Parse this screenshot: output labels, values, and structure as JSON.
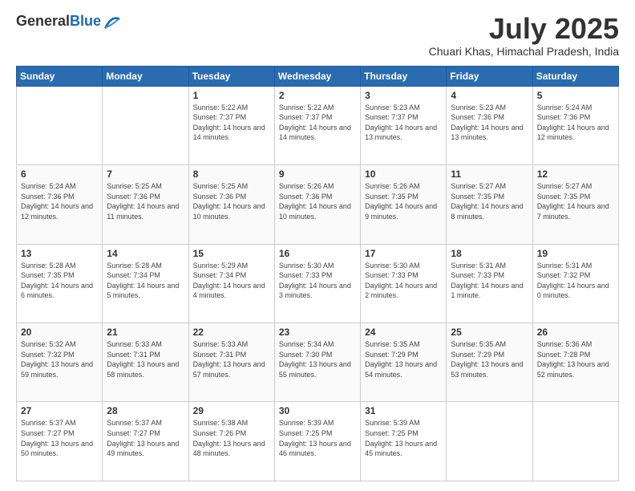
{
  "header": {
    "logo": {
      "general": "General",
      "blue": "Blue"
    },
    "title": "July 2025",
    "location": "Chuari Khas, Himachal Pradesh, India"
  },
  "weekdays": [
    "Sunday",
    "Monday",
    "Tuesday",
    "Wednesday",
    "Thursday",
    "Friday",
    "Saturday"
  ],
  "weeks": [
    [
      {
        "day": "",
        "sunrise": "",
        "sunset": "",
        "daylight": ""
      },
      {
        "day": "",
        "sunrise": "",
        "sunset": "",
        "daylight": ""
      },
      {
        "day": "1",
        "sunrise": "Sunrise: 5:22 AM",
        "sunset": "Sunset: 7:37 PM",
        "daylight": "Daylight: 14 hours and 14 minutes."
      },
      {
        "day": "2",
        "sunrise": "Sunrise: 5:22 AM",
        "sunset": "Sunset: 7:37 PM",
        "daylight": "Daylight: 14 hours and 14 minutes."
      },
      {
        "day": "3",
        "sunrise": "Sunrise: 5:23 AM",
        "sunset": "Sunset: 7:37 PM",
        "daylight": "Daylight: 14 hours and 13 minutes."
      },
      {
        "day": "4",
        "sunrise": "Sunrise: 5:23 AM",
        "sunset": "Sunset: 7:36 PM",
        "daylight": "Daylight: 14 hours and 13 minutes."
      },
      {
        "day": "5",
        "sunrise": "Sunrise: 5:24 AM",
        "sunset": "Sunset: 7:36 PM",
        "daylight": "Daylight: 14 hours and 12 minutes."
      }
    ],
    [
      {
        "day": "6",
        "sunrise": "Sunrise: 5:24 AM",
        "sunset": "Sunset: 7:36 PM",
        "daylight": "Daylight: 14 hours and 12 minutes."
      },
      {
        "day": "7",
        "sunrise": "Sunrise: 5:25 AM",
        "sunset": "Sunset: 7:36 PM",
        "daylight": "Daylight: 14 hours and 11 minutes."
      },
      {
        "day": "8",
        "sunrise": "Sunrise: 5:25 AM",
        "sunset": "Sunset: 7:36 PM",
        "daylight": "Daylight: 14 hours and 10 minutes."
      },
      {
        "day": "9",
        "sunrise": "Sunrise: 5:26 AM",
        "sunset": "Sunset: 7:36 PM",
        "daylight": "Daylight: 14 hours and 10 minutes."
      },
      {
        "day": "10",
        "sunrise": "Sunrise: 5:26 AM",
        "sunset": "Sunset: 7:35 PM",
        "daylight": "Daylight: 14 hours and 9 minutes."
      },
      {
        "day": "11",
        "sunrise": "Sunrise: 5:27 AM",
        "sunset": "Sunset: 7:35 PM",
        "daylight": "Daylight: 14 hours and 8 minutes."
      },
      {
        "day": "12",
        "sunrise": "Sunrise: 5:27 AM",
        "sunset": "Sunset: 7:35 PM",
        "daylight": "Daylight: 14 hours and 7 minutes."
      }
    ],
    [
      {
        "day": "13",
        "sunrise": "Sunrise: 5:28 AM",
        "sunset": "Sunset: 7:35 PM",
        "daylight": "Daylight: 14 hours and 6 minutes."
      },
      {
        "day": "14",
        "sunrise": "Sunrise: 5:28 AM",
        "sunset": "Sunset: 7:34 PM",
        "daylight": "Daylight: 14 hours and 5 minutes."
      },
      {
        "day": "15",
        "sunrise": "Sunrise: 5:29 AM",
        "sunset": "Sunset: 7:34 PM",
        "daylight": "Daylight: 14 hours and 4 minutes."
      },
      {
        "day": "16",
        "sunrise": "Sunrise: 5:30 AM",
        "sunset": "Sunset: 7:33 PM",
        "daylight": "Daylight: 14 hours and 3 minutes."
      },
      {
        "day": "17",
        "sunrise": "Sunrise: 5:30 AM",
        "sunset": "Sunset: 7:33 PM",
        "daylight": "Daylight: 14 hours and 2 minutes."
      },
      {
        "day": "18",
        "sunrise": "Sunrise: 5:31 AM",
        "sunset": "Sunset: 7:33 PM",
        "daylight": "Daylight: 14 hours and 1 minute."
      },
      {
        "day": "19",
        "sunrise": "Sunrise: 5:31 AM",
        "sunset": "Sunset: 7:32 PM",
        "daylight": "Daylight: 14 hours and 0 minutes."
      }
    ],
    [
      {
        "day": "20",
        "sunrise": "Sunrise: 5:32 AM",
        "sunset": "Sunset: 7:32 PM",
        "daylight": "Daylight: 13 hours and 59 minutes."
      },
      {
        "day": "21",
        "sunrise": "Sunrise: 5:33 AM",
        "sunset": "Sunset: 7:31 PM",
        "daylight": "Daylight: 13 hours and 58 minutes."
      },
      {
        "day": "22",
        "sunrise": "Sunrise: 5:33 AM",
        "sunset": "Sunset: 7:31 PM",
        "daylight": "Daylight: 13 hours and 57 minutes."
      },
      {
        "day": "23",
        "sunrise": "Sunrise: 5:34 AM",
        "sunset": "Sunset: 7:30 PM",
        "daylight": "Daylight: 13 hours and 55 minutes."
      },
      {
        "day": "24",
        "sunrise": "Sunrise: 5:35 AM",
        "sunset": "Sunset: 7:29 PM",
        "daylight": "Daylight: 13 hours and 54 minutes."
      },
      {
        "day": "25",
        "sunrise": "Sunrise: 5:35 AM",
        "sunset": "Sunset: 7:29 PM",
        "daylight": "Daylight: 13 hours and 53 minutes."
      },
      {
        "day": "26",
        "sunrise": "Sunrise: 5:36 AM",
        "sunset": "Sunset: 7:28 PM",
        "daylight": "Daylight: 13 hours and 52 minutes."
      }
    ],
    [
      {
        "day": "27",
        "sunrise": "Sunrise: 5:37 AM",
        "sunset": "Sunset: 7:27 PM",
        "daylight": "Daylight: 13 hours and 50 minutes."
      },
      {
        "day": "28",
        "sunrise": "Sunrise: 5:37 AM",
        "sunset": "Sunset: 7:27 PM",
        "daylight": "Daylight: 13 hours and 49 minutes."
      },
      {
        "day": "29",
        "sunrise": "Sunrise: 5:38 AM",
        "sunset": "Sunset: 7:26 PM",
        "daylight": "Daylight: 13 hours and 48 minutes."
      },
      {
        "day": "30",
        "sunrise": "Sunrise: 5:39 AM",
        "sunset": "Sunset: 7:25 PM",
        "daylight": "Daylight: 13 hours and 46 minutes."
      },
      {
        "day": "31",
        "sunrise": "Sunrise: 5:39 AM",
        "sunset": "Sunset: 7:25 PM",
        "daylight": "Daylight: 13 hours and 45 minutes."
      },
      {
        "day": "",
        "sunrise": "",
        "sunset": "",
        "daylight": ""
      },
      {
        "day": "",
        "sunrise": "",
        "sunset": "",
        "daylight": ""
      }
    ]
  ]
}
